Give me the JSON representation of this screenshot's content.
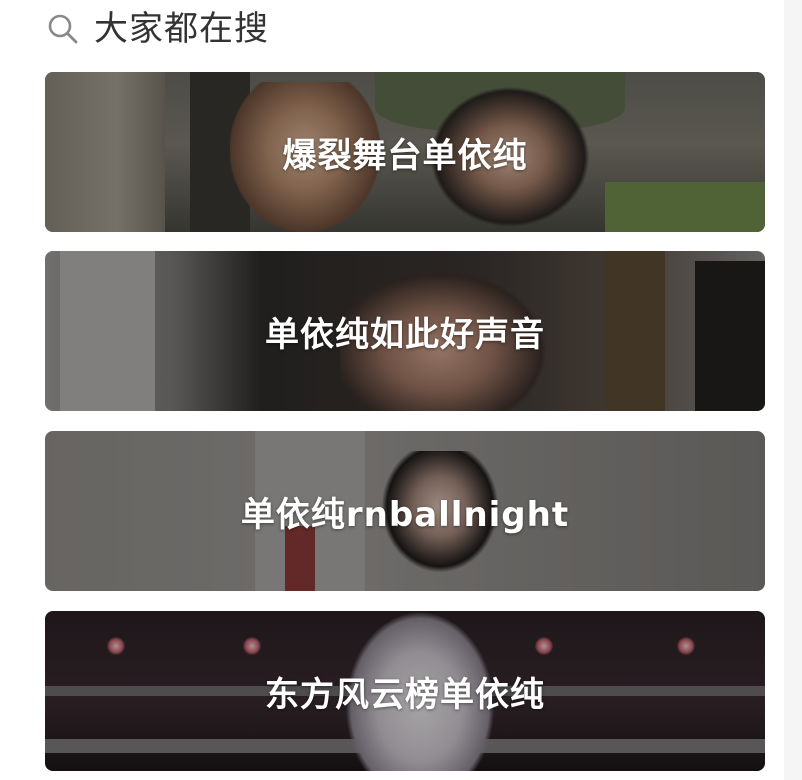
{
  "header": {
    "icon": "search-icon",
    "title": "大家都在搜"
  },
  "cards": [
    {
      "label": "爆裂舞台单依纯"
    },
    {
      "label": "单依纯如此好声音"
    },
    {
      "label": "单依纯rnballnight"
    },
    {
      "label": "东方风云榜单依纯"
    }
  ],
  "colors": {
    "title_text": "#333333",
    "icon_stroke": "#888888",
    "card_label": "#ffffff"
  }
}
